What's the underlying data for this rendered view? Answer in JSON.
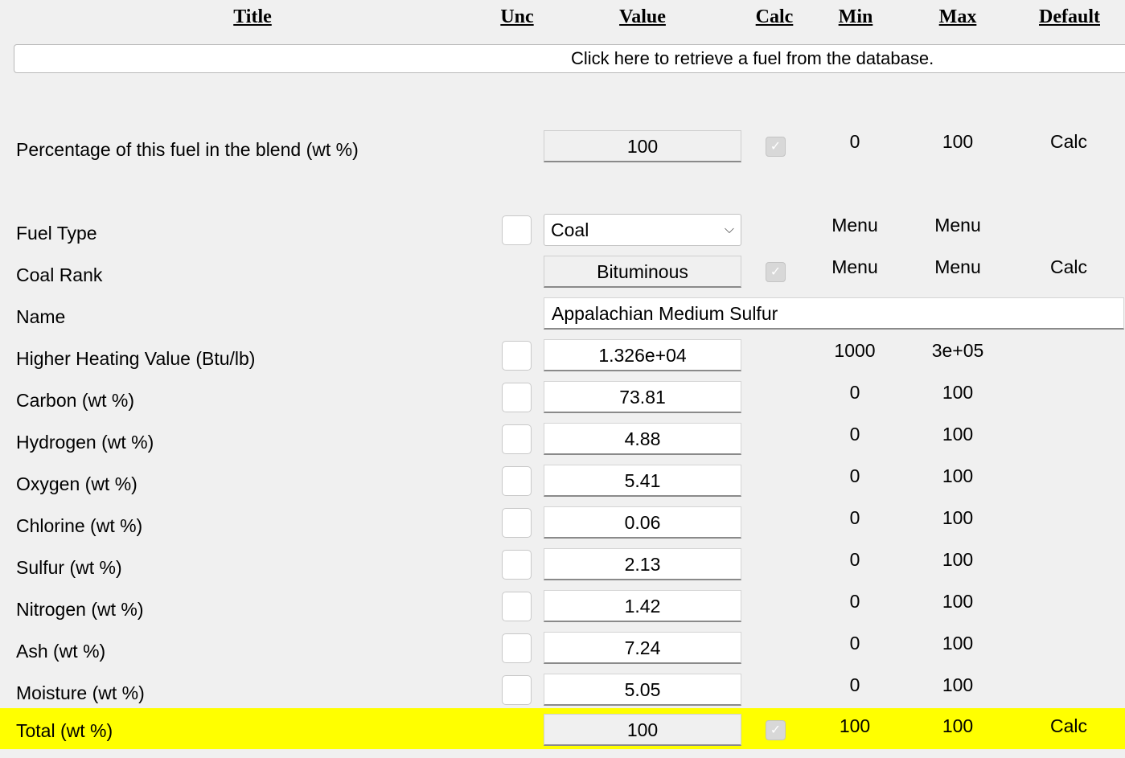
{
  "headers": {
    "title": "Title",
    "unc": "Unc",
    "value": "Value",
    "calc": "Calc",
    "min": "Min",
    "max": "Max",
    "default": "Default"
  },
  "db_button_label": "Click here to retrieve a fuel from the database.",
  "calc_check_glyph": "✓",
  "dropdown_chevron": "⌵",
  "rows": {
    "blend": {
      "label": "Percentage of this fuel in the blend (wt %)",
      "value": "100",
      "min": "0",
      "max": "100",
      "default": "Calc",
      "calc_checked": true
    },
    "fuel_type": {
      "label": "Fuel Type",
      "value": "Coal",
      "min": "Menu",
      "max": "Menu"
    },
    "coal_rank": {
      "label": "Coal Rank",
      "value": "Bituminous",
      "min": "Menu",
      "max": "Menu",
      "default": "Calc",
      "calc_checked": true
    },
    "name": {
      "label": "Name",
      "value": "Appalachian Medium Sulfur"
    },
    "hhv": {
      "label": "Higher Heating Value (Btu/lb)",
      "value": "1.326e+04",
      "min": "1000",
      "max": "3e+05"
    },
    "carbon": {
      "label": "Carbon (wt %)",
      "value": "73.81",
      "min": "0",
      "max": "100"
    },
    "hydrogen": {
      "label": "Hydrogen (wt %)",
      "value": "4.88",
      "min": "0",
      "max": "100"
    },
    "oxygen": {
      "label": "Oxygen (wt %)",
      "value": "5.41",
      "min": "0",
      "max": "100"
    },
    "chlorine": {
      "label": "Chlorine (wt %)",
      "value": "0.06",
      "min": "0",
      "max": "100"
    },
    "sulfur": {
      "label": "Sulfur (wt %)",
      "value": "2.13",
      "min": "0",
      "max": "100"
    },
    "nitrogen": {
      "label": "Nitrogen (wt %)",
      "value": "1.42",
      "min": "0",
      "max": "100"
    },
    "ash": {
      "label": "Ash (wt %)",
      "value": "7.24",
      "min": "0",
      "max": "100"
    },
    "moisture": {
      "label": "Moisture (wt %)",
      "value": "5.05",
      "min": "0",
      "max": "100"
    },
    "total": {
      "label": "Total (wt %)",
      "value": "100",
      "min": "100",
      "max": "100",
      "default": "Calc",
      "calc_checked": true
    }
  },
  "colors": {
    "highlight": "#ffff00",
    "background": "#f0f0f0"
  }
}
